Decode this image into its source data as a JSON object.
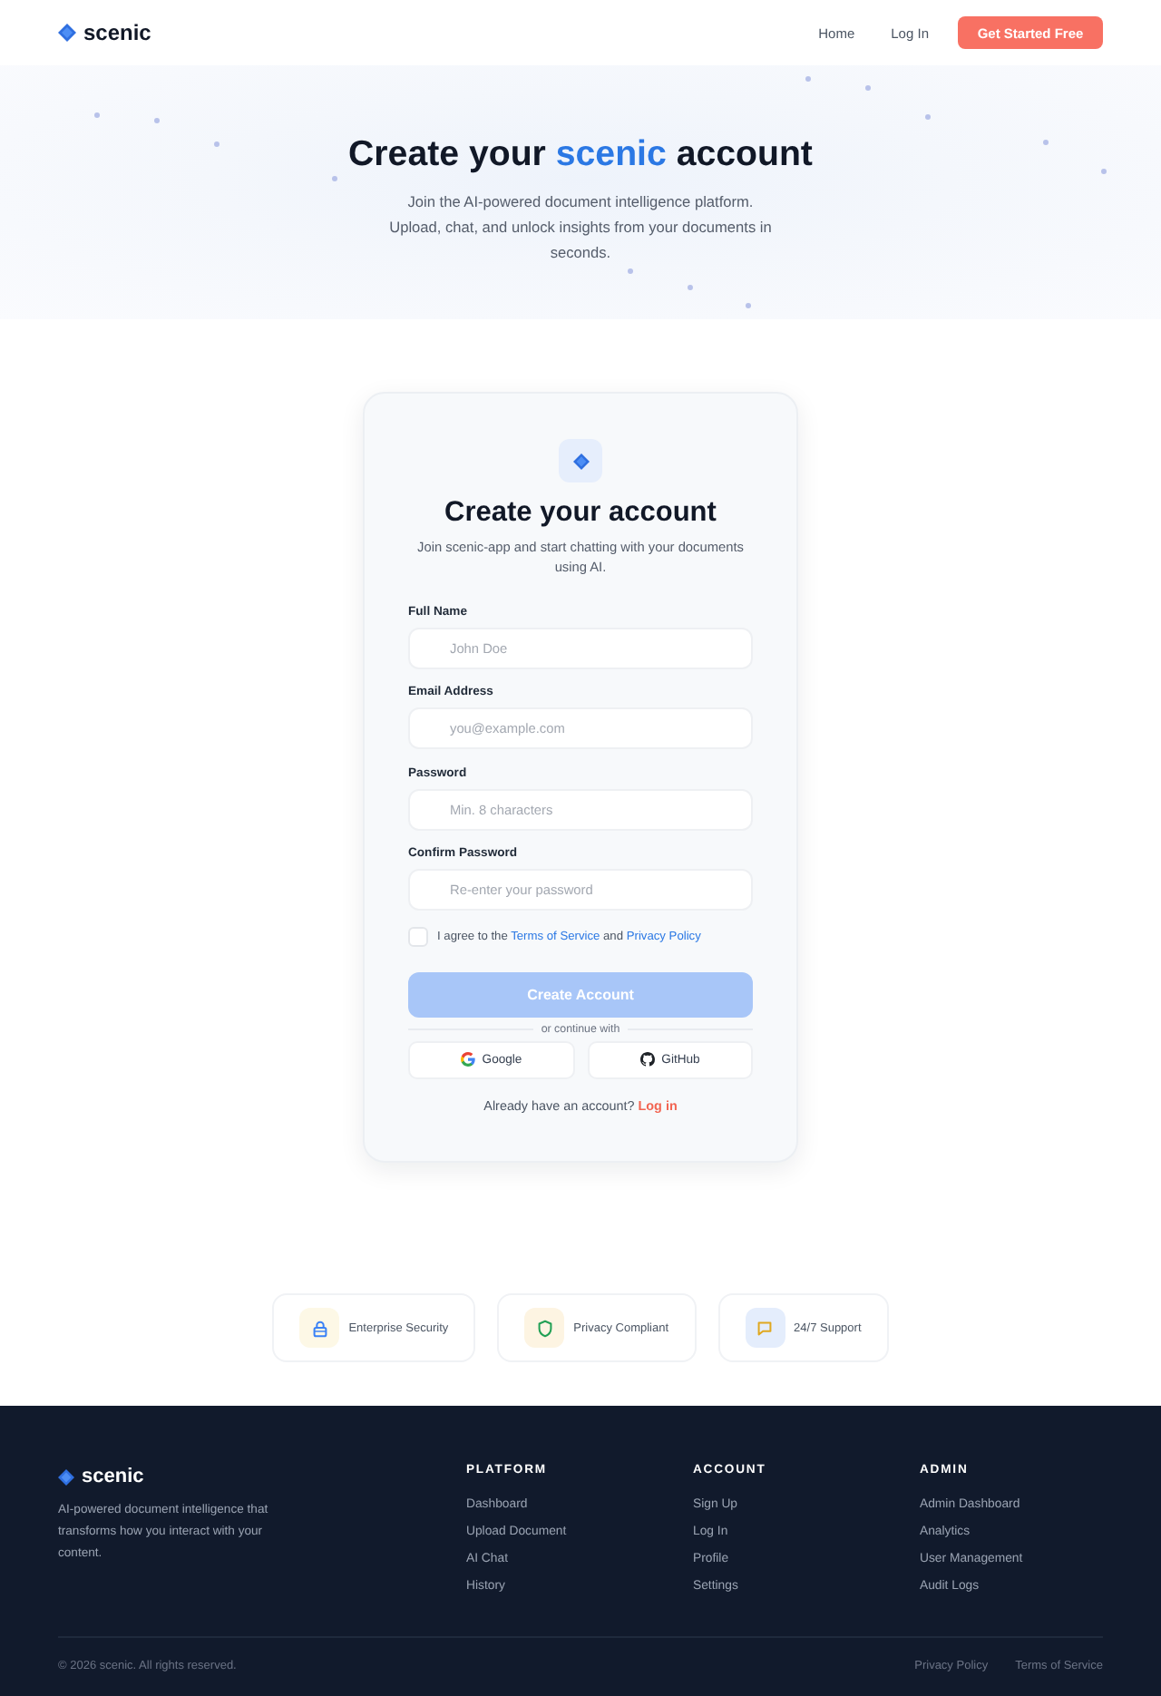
{
  "header": {
    "logo": "scenic",
    "nav": [
      {
        "label": "Home"
      },
      {
        "label": "Log In"
      }
    ],
    "cta": "Get Started Free"
  },
  "hero": {
    "title_before": "Create your ",
    "title_highlight": "scenic",
    "title_after": " account",
    "subtitle": "Join the AI-powered document intelligence platform. Upload, chat, and unlock insights from your documents in seconds."
  },
  "card": {
    "title": "Create your account",
    "subtitle": "Join scenic-app and start chatting with your documents using AI.",
    "fields": [
      {
        "label": "Full Name",
        "placeholder": "John Doe"
      },
      {
        "label": "Email Address",
        "placeholder": "you@example.com"
      },
      {
        "label": "Password",
        "placeholder": "Min. 8 characters"
      },
      {
        "label": "Confirm Password",
        "placeholder": "Re-enter your password"
      }
    ],
    "agree": {
      "checked": false,
      "text_before": "I agree to the ",
      "terms": "Terms of Service",
      "text_middle": " and ",
      "privacy": "Privacy Policy"
    },
    "submit": {
      "label": "Create Account",
      "disabled": true
    },
    "divider": "or continue with",
    "social": [
      {
        "label": "Google",
        "kind": "google"
      },
      {
        "label": "GitHub",
        "kind": "github"
      }
    ],
    "login_prompt": "Already have an account? ",
    "login_link": "Log in"
  },
  "features": [
    {
      "label": "Enterprise Security",
      "kind": "lock"
    },
    {
      "label": "Privacy Compliant",
      "kind": "shield"
    },
    {
      "label": "24/7 Support",
      "kind": "chat"
    }
  ],
  "footer": {
    "logo": "scenic",
    "tagline": "AI-powered document intelligence that transforms how you interact with your content.",
    "columns": [
      {
        "heading": "PLATFORM",
        "links": [
          "Dashboard",
          "Upload Document",
          "AI Chat",
          "History"
        ]
      },
      {
        "heading": "ACCOUNT",
        "links": [
          "Sign Up",
          "Log In",
          "Profile",
          "Settings"
        ]
      },
      {
        "heading": "ADMIN",
        "links": [
          "Admin Dashboard",
          "Analytics",
          "User Management",
          "Audit Logs"
        ]
      }
    ],
    "copyright": "© 2026 scenic. All rights reserved.",
    "legal": [
      "Privacy Policy",
      "Terms of Service"
    ]
  }
}
